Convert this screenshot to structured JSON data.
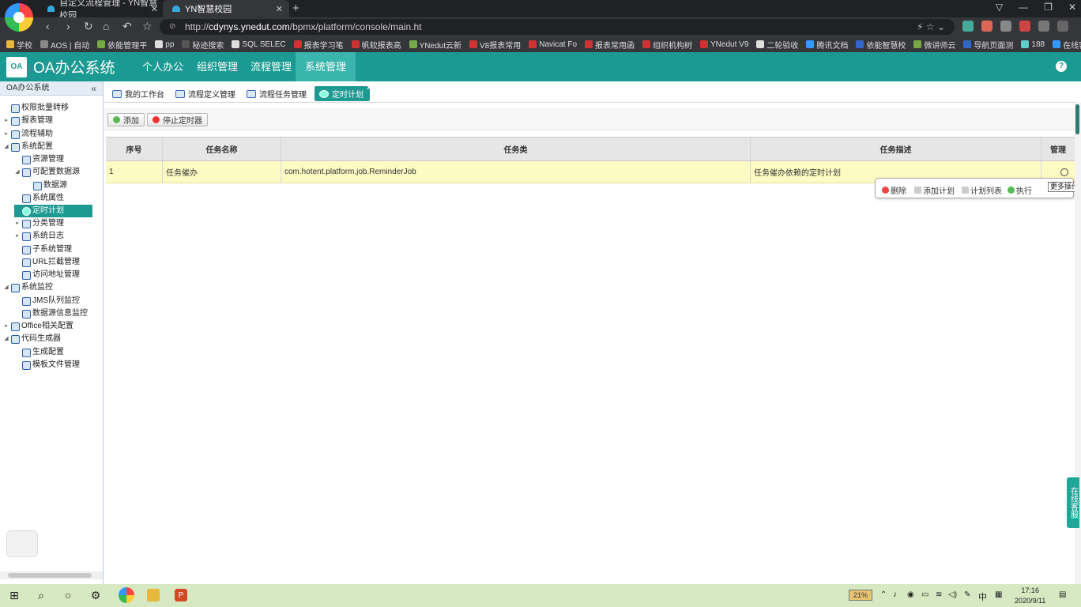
{
  "browser": {
    "tabs": [
      {
        "title": "自定义流程管理 - YN智慧校园"
      },
      {
        "title": "YN智慧校园"
      }
    ],
    "url_host": "cdynys.ynedut.com",
    "url_path": "/bpmx/platform/console/main.ht",
    "url_prefix": "http://",
    "bookmarks": [
      "学校",
      "AOS | 自动",
      "依能管理平",
      "pp",
      "秘迹搜索",
      "SQL SELEC",
      "报表学习笔",
      "帆软报表高",
      "YNedut云新",
      "V8报表常用",
      "Navicat Fo",
      "报表常用函",
      "组织机构树",
      "YNedut V9",
      "二轮验收",
      "腾讯文档",
      "依能智慧校",
      "微讲师云",
      "导航页面测",
      "188",
      "在线客服主"
    ]
  },
  "app": {
    "title": "OA办公系统",
    "logo_text": "OA",
    "nav": [
      "个人办公",
      "组织管理",
      "流程管理",
      "系统管理"
    ],
    "nav_selected": "系统管理",
    "help_icon": "?"
  },
  "sidebar": {
    "title": "OA办公系统",
    "items": [
      {
        "label": "权限批量转移"
      },
      {
        "label": "报表管理"
      },
      {
        "label": "流程辅助"
      },
      {
        "label": "系统配置"
      },
      {
        "label": "资源管理"
      },
      {
        "label": "可配置数据源"
      },
      {
        "label": "数据源"
      },
      {
        "label": "系统属性"
      },
      {
        "label": "定时计划"
      },
      {
        "label": "分类管理"
      },
      {
        "label": "系统日志"
      },
      {
        "label": "子系统管理"
      },
      {
        "label": "URL拦截管理"
      },
      {
        "label": "访问地址管理"
      },
      {
        "label": "系统监控"
      },
      {
        "label": "JMS队列监控"
      },
      {
        "label": "数据源信息监控"
      },
      {
        "label": "Office相关配置"
      },
      {
        "label": "代码生成器"
      },
      {
        "label": "生成配置"
      },
      {
        "label": "模板文件管理"
      }
    ]
  },
  "tabs": [
    {
      "label": "我的工作台"
    },
    {
      "label": "流程定义管理"
    },
    {
      "label": "流程任务管理"
    },
    {
      "label": "定时计划"
    }
  ],
  "toolbar": {
    "add_label": "添加",
    "stop_label": "停止定时器"
  },
  "grid": {
    "columns": [
      "序号",
      "任务名称",
      "任务类",
      "任务描述",
      "管理"
    ],
    "rows": [
      {
        "index": "1",
        "name": "任务催办",
        "class": "com.hotent.platform.job.ReminderJob",
        "desc": "任务催办依赖的定时计划"
      }
    ]
  },
  "popup": {
    "items": [
      "删除",
      "添加计划",
      "计划列表",
      "执行"
    ]
  },
  "tooltip": "更多操作",
  "online_service": "在线客服",
  "taskbar": {
    "battery": "21%",
    "ime": "中",
    "time": "17:16",
    "date": "2020/9/11"
  },
  "colors": {
    "accent": "#1a9a92",
    "row_highlight": "#fdfbc4",
    "taskbar": "#d6e9c2"
  }
}
